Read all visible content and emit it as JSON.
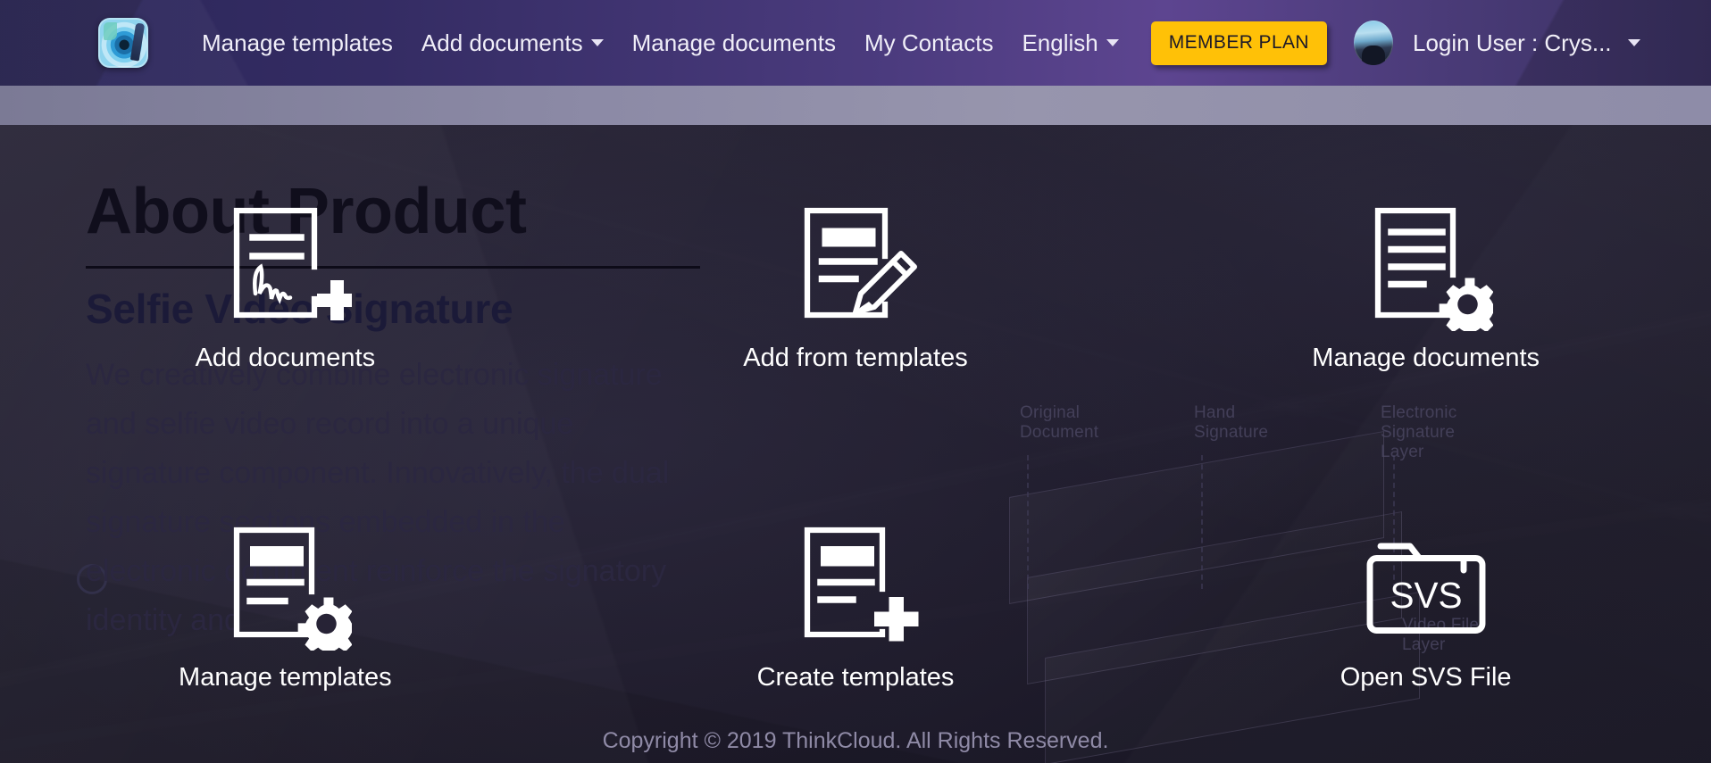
{
  "navbar": {
    "brand_logo_icon": "eye-pen-logo-icon",
    "links": [
      {
        "label": "Manage templates",
        "has_caret": false
      },
      {
        "label": "Add documents",
        "has_caret": true
      },
      {
        "label": "Manage documents",
        "has_caret": false
      },
      {
        "label": "My Contacts",
        "has_caret": false
      },
      {
        "label": "English",
        "has_caret": true
      }
    ],
    "member_plan_label": "MEMBER PLAN",
    "member_plan_color": "#ffc107",
    "user_label": "Login User : Crys...",
    "avatar_icon": "user-avatar"
  },
  "background_page": {
    "title": "About Product",
    "subtitle": "Selfie Video Signature",
    "body": "We creatively combine electronic signature and selfie video record into a unique signature component. Innovatively, the dual signature sections embedded in the electronic document reinforce the signatory identity and",
    "diagram_labels": [
      "Original Document",
      "Hand Signature",
      "Electronic Signature Layer",
      "Video File Layer"
    ]
  },
  "menu": {
    "tiles": [
      {
        "label": "Add documents",
        "icon": "document-signature-plus-icon"
      },
      {
        "label": "Add from templates",
        "icon": "document-pencil-icon"
      },
      {
        "label": "Manage documents",
        "icon": "document-gear-icon"
      },
      {
        "label": "Manage templates",
        "icon": "template-gear-icon"
      },
      {
        "label": "Create templates",
        "icon": "template-plus-icon"
      },
      {
        "label": "Open SVS File",
        "icon": "folder-svs-icon"
      }
    ]
  },
  "footer": {
    "copyright": "Copyright © 2019 ThinkCloud. All Rights Reserved."
  }
}
